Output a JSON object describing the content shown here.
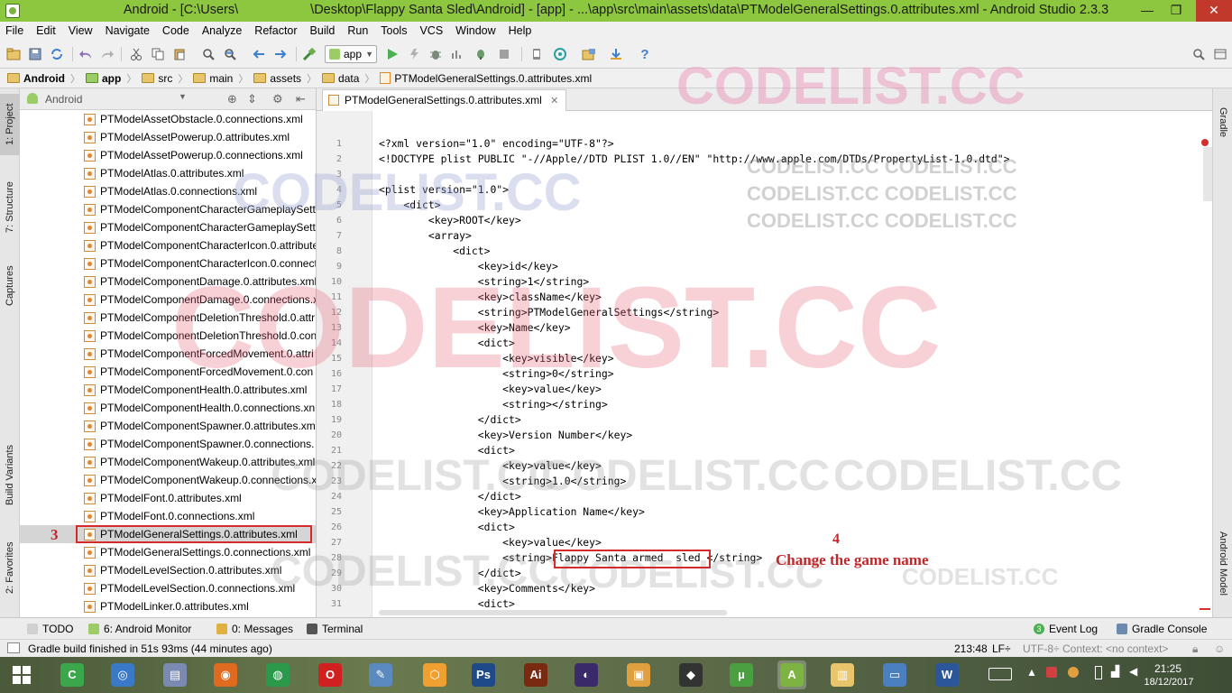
{
  "window": {
    "title": "Android - [C:\\Users\\          \\Desktop\\Flappy Santa Sled\\Android] - [app] - ...\\app\\src\\main\\assets\\data\\PTModelGeneralSettings.0.attributes.xml - Android Studio 2.3.3",
    "title_left": "Android - [C:\\Users\\",
    "title_right": "\\Desktop\\Flappy Santa Sled\\Android] - [app] - ...\\app\\src\\main\\assets\\data\\PTModelGeneralSettings.0.attributes.xml - Android Studio 2.3.3",
    "minimize": "—",
    "maximize": "❐",
    "close": "✕"
  },
  "menu": [
    "File",
    "Edit",
    "View",
    "Navigate",
    "Code",
    "Analyze",
    "Refactor",
    "Build",
    "Run",
    "Tools",
    "VCS",
    "Window",
    "Help"
  ],
  "toolbar": {
    "run_config": "app",
    "help": "?"
  },
  "breadcrumb": [
    "Android",
    "app",
    "src",
    "main",
    "assets",
    "data",
    "PTModelGeneralSettings.0.attributes.xml"
  ],
  "left_tabs": [
    "1: Project",
    "7: Structure",
    "Captures",
    "Build Variants",
    "2: Favorites"
  ],
  "right_tabs": [
    "Gradle",
    "Android Model"
  ],
  "project": {
    "view_label": "Android",
    "files": [
      "PTModelAssetObstacle.0.connections.xml",
      "PTModelAssetPowerup.0.attributes.xml",
      "PTModelAssetPowerup.0.connections.xml",
      "PTModelAtlas.0.attributes.xml",
      "PTModelAtlas.0.connections.xml",
      "PTModelComponentCharacterGameplaySetti",
      "PTModelComponentCharacterGameplaySetti",
      "PTModelComponentCharacterIcon.0.attribute",
      "PTModelComponentCharacterIcon.0.connect",
      "PTModelComponentDamage.0.attributes.xml",
      "PTModelComponentDamage.0.connections.x",
      "PTModelComponentDeletionThreshold.0.attr",
      "PTModelComponentDeletionThreshold.0.con",
      "PTModelComponentForcedMovement.0.attri",
      "PTModelComponentForcedMovement.0.con",
      "PTModelComponentHealth.0.attributes.xml",
      "PTModelComponentHealth.0.connections.xn",
      "PTModelComponentSpawner.0.attributes.xm",
      "PTModelComponentSpawner.0.connections.",
      "PTModelComponentWakeup.0.attributes.xml",
      "PTModelComponentWakeup.0.connections.x",
      "PTModelFont.0.attributes.xml",
      "PTModelFont.0.connections.xml",
      "PTModelGeneralSettings.0.attributes.xml",
      "PTModelGeneralSettings.0.connections.xml",
      "PTModelLevelSection.0.attributes.xml",
      "PTModelLevelSection.0.connections.xml",
      "PTModelLinker.0.attributes.xml"
    ],
    "selected_index": 23
  },
  "editor": {
    "tab_label": "PTModelGeneralSettings.0.attributes.xml",
    "tab_close": "✕",
    "line_numbers": [
      "1",
      "2",
      "3",
      "4",
      "5",
      "6",
      "7",
      "8",
      "9",
      "10",
      "11",
      "12",
      "13",
      "14",
      "15",
      "16",
      "17",
      "18",
      "19",
      "20",
      "21",
      "22",
      "23",
      "24",
      "25",
      "26",
      "27",
      "28",
      "29",
      "30",
      "31"
    ],
    "lines": [
      "<?xml version=\"1.0\" encoding=\"UTF-8\"?>",
      "<!DOCTYPE plist PUBLIC \"-//Apple//DTD PLIST 1.0//EN\" \"http://www.apple.com/DTDs/PropertyList-1.0.dtd\">",
      "",
      "<plist version=\"1.0\">",
      "    <dict>",
      "        <key>ROOT</key>",
      "        <array>",
      "            <dict>",
      "                <key>id</key>",
      "                <string>1</string>",
      "                <key>className</key>",
      "                <string>PTModelGeneralSettings</string>",
      "                <key>Name</key>",
      "                <dict>",
      "                    <key>visible</key>",
      "                    <string>0</string>",
      "                    <key>value</key>",
      "                    <string></string>",
      "                </dict>",
      "                <key>Version Number</key>",
      "                <dict>",
      "                    <key>value</key>",
      "                    <string>1.0</string>",
      "                </dict>",
      "                <key>Application Name</key>",
      "                <dict>",
      "                    <key>value</key>",
      "                    <string>Flappy Santa armed  sled </string>",
      "                </dict>",
      "                <key>Comments</key>",
      "                <dict>"
    ]
  },
  "annotations": {
    "step3": "3",
    "step4": "4",
    "change_name": "Change the game name"
  },
  "watermarks": {
    "text": "CODELIST.CC",
    "repeat_line": "CODELIST.CC CODELIST.CC"
  },
  "bottom_tools": {
    "todo": "TODO",
    "android_monitor": "6: Android Monitor",
    "messages": "0: Messages",
    "terminal": "Terminal",
    "event_log": "Event Log",
    "event_log_count": "3",
    "gradle_console": "Gradle Console"
  },
  "status": {
    "message": "Gradle build finished in 51s 93ms (44 minutes ago)",
    "position": "213:48",
    "line_sep": "LF÷",
    "encoding": "UTF-8÷",
    "context": "Context: <no context>"
  },
  "taskbar": {
    "time": "21:25",
    "date": "18/12/2017",
    "apps": [
      "Camtasia",
      "Thunderbird",
      "Computer",
      "Firefox",
      "Chrome",
      "Opera",
      "Paint",
      "Sublime",
      "Photoshop",
      "Illustrator",
      "Eclipse",
      "Package",
      "Unity",
      "uTorrent",
      "Android Studio",
      "Explorer",
      "Screen",
      "Word"
    ]
  },
  "colors": {
    "titlebar": "#8dc63f",
    "annotation_red": "#c0282c",
    "watermark_pink": "#e8a0b8",
    "watermark_gray": "#b0b0b0",
    "watermark_blue": "#b8bee0"
  }
}
